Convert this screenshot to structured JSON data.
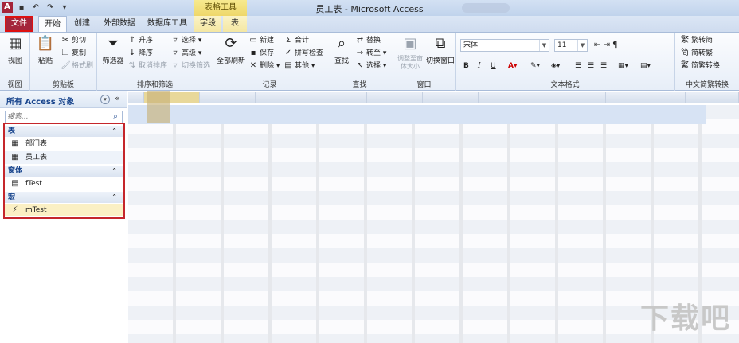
{
  "app": {
    "logo_letter": "A",
    "title": "员工表 - Microsoft Access",
    "context_tab_header": "表格工具"
  },
  "tabs": [
    {
      "label": "文件"
    },
    {
      "label": "开始"
    },
    {
      "label": "创建"
    },
    {
      "label": "外部数据"
    },
    {
      "label": "数据库工具"
    },
    {
      "label": "字段"
    },
    {
      "label": "表"
    }
  ],
  "ribbon": {
    "views": {
      "view_label": "视图",
      "group": "视图"
    },
    "clipboard": {
      "paste": "粘贴",
      "cut": "剪切",
      "copy": "复制",
      "format_painter": "格式刷",
      "group": "剪贴板"
    },
    "sort_filter": {
      "filter": "筛选器",
      "ascending": "升序",
      "descending": "降序",
      "remove_sort": "取消排序",
      "selection": "选择",
      "advanced": "高级",
      "toggle_filter": "切换筛选",
      "group": "排序和筛选"
    },
    "records": {
      "refresh_all": "全部刷新",
      "new": "新建",
      "save": "保存",
      "delete": "删除",
      "totals": "合计",
      "spelling": "拼写检查",
      "more": "其他",
      "group": "记录"
    },
    "find": {
      "find": "查找",
      "replace": "替换",
      "goto": "转至",
      "select": "选择",
      "group": "查找"
    },
    "window": {
      "fit": "调整至窗体大小",
      "switch": "切换窗口",
      "group": "窗口"
    },
    "text_format": {
      "font": "宋体",
      "size": "11",
      "bold": "B",
      "italic": "I",
      "underline": "U",
      "group": "文本格式"
    },
    "chinese_convert": {
      "to_trad": "繁转简",
      "to_simp": "简转繁",
      "convert": "简繁转换",
      "group": "中文简繁转换"
    }
  },
  "nav": {
    "title": "所有 Access 对象",
    "search_placeholder": "搜索...",
    "groups": [
      {
        "label": "表",
        "items": [
          {
            "label": "部门表"
          },
          {
            "label": "员工表"
          }
        ]
      },
      {
        "label": "窗体",
        "items": [
          {
            "label": "fTest"
          }
        ]
      },
      {
        "label": "宏",
        "items": [
          {
            "label": "mTest"
          }
        ]
      }
    ]
  },
  "watermark": "下载吧"
}
